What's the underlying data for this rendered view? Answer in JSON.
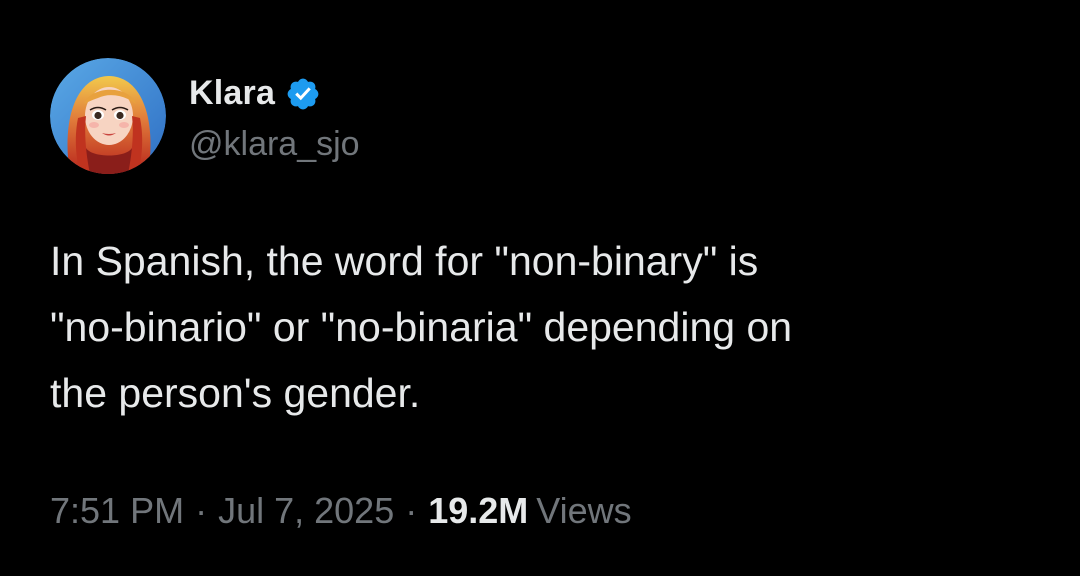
{
  "colors": {
    "background": "#000000",
    "primary_text": "#e7e9ea",
    "secondary_text": "#71767b",
    "verified_badge": "#1d9bf0"
  },
  "author": {
    "display_name": "Klara",
    "handle": "@klara_sjo",
    "verified": true,
    "verified_icon": "verified-badge-icon",
    "avatar_icon": "cartoon-avatar"
  },
  "tweet": {
    "text": "In Spanish, the word for \"non-binary\" is\n\"no-binario\" or \"no-binaria\" depending on\nthe person's gender."
  },
  "meta": {
    "time": "7:51 PM",
    "separator": "·",
    "date": "Jul 7, 2025",
    "views_count": "19.2M",
    "views_label": "Views"
  }
}
